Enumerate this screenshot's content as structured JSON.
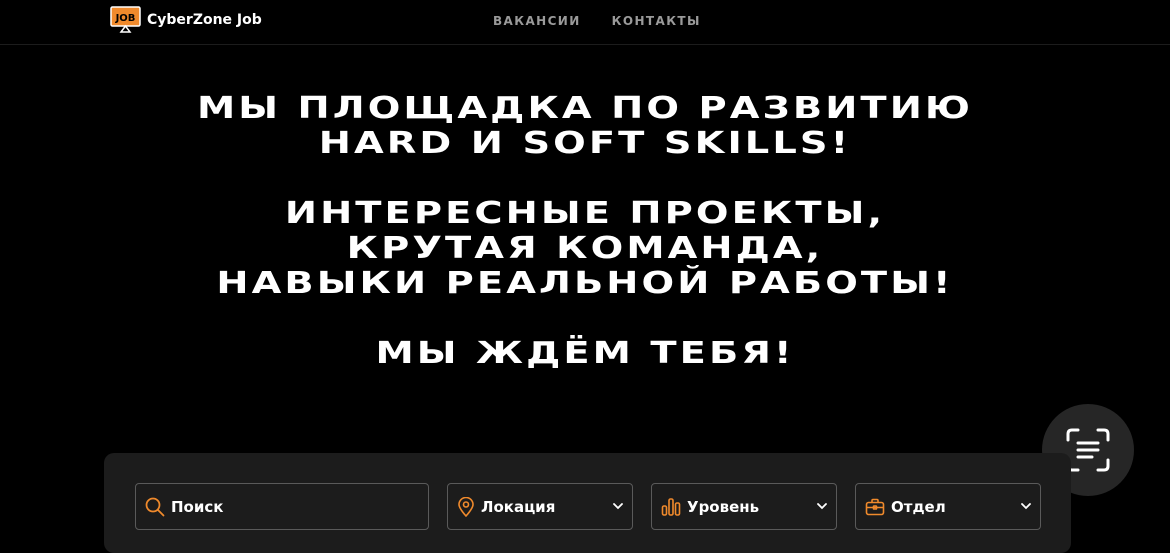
{
  "header": {
    "logo_mark_text": "JOB",
    "brand": "CyberZone Job",
    "nav": [
      {
        "label": "ВАКАНСИИ"
      },
      {
        "label": "КОНТАКТЫ"
      }
    ]
  },
  "hero": {
    "line1": "Мы площадка по развитию",
    "line2": "hard и soft skills!",
    "line3": "Интересные проекты,",
    "line4": "крутая команда,",
    "line5": "навыки реальной работы!",
    "line6": "Мы ждём тебя!"
  },
  "filters": {
    "search_placeholder": "Поиск",
    "location_label": "Локация",
    "level_label": "Уровень",
    "department_label": "Отдел"
  },
  "icons": {
    "search": "search-icon",
    "location": "location-pin-icon",
    "level": "bar-levels-icon",
    "department": "briefcase-icon",
    "chevron": "chevron-down-icon",
    "scan": "text-scan-icon"
  },
  "colors": {
    "accent": "#f08a2c",
    "background": "#000000",
    "panel": "#1c1c1c",
    "nav_text": "#9a9a9a"
  }
}
